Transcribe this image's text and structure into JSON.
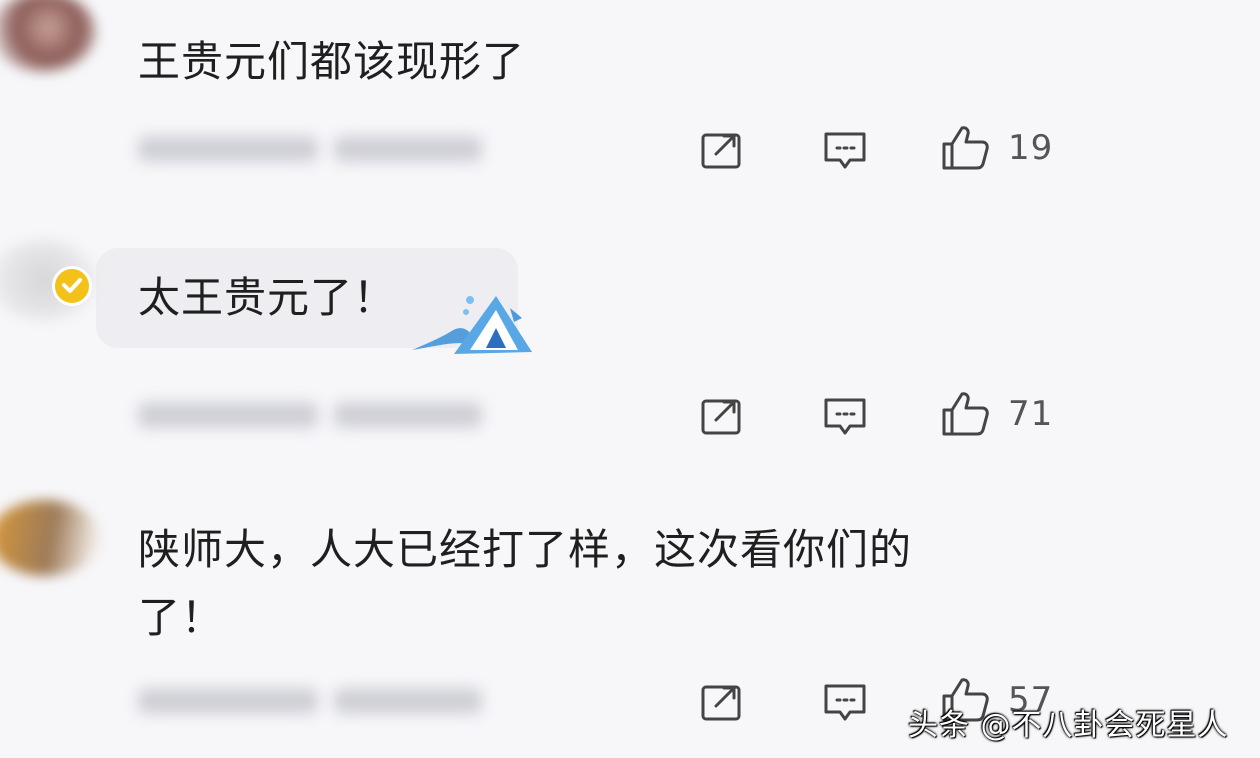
{
  "comments": [
    {
      "text": "王贵元们都该现形了",
      "likes": "19"
    },
    {
      "text": "太王贵元了！",
      "likes": "71"
    },
    {
      "text_line1": "陕师大，人大已经打了样，这次看你们的",
      "text_line2": "了！",
      "likes": "57"
    }
  ],
  "watermark": "头条 @不八卦会死星人",
  "icons": [
    "share-icon",
    "comment-icon",
    "like-icon",
    "verified-icon"
  ],
  "colors": {
    "background": "#f7f7fa",
    "verified": "#f3c21a",
    "icon": "#444444"
  }
}
